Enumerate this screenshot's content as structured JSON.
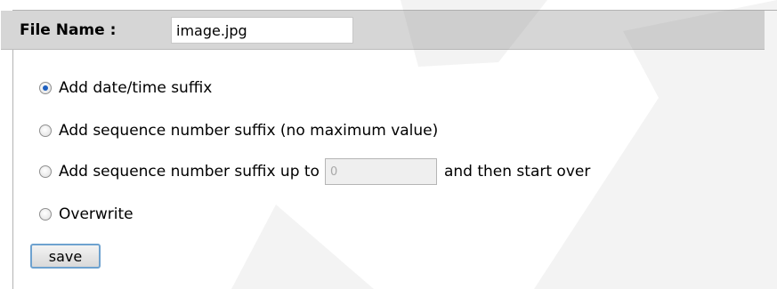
{
  "file_name": {
    "label": "File Name :",
    "value": "image.jpg"
  },
  "options": [
    {
      "label": "Add date/time suffix",
      "checked": true
    },
    {
      "label": "Add sequence number suffix (no maximum value)",
      "checked": false
    },
    {
      "label_before": "Add sequence number suffix up to",
      "input_value": "0",
      "label_after": "and then start over",
      "checked": false
    },
    {
      "label": "Overwrite",
      "checked": false
    }
  ],
  "save_label": "save",
  "colors": {
    "header_bg": "#d6d6d6",
    "radio_dot": "#1e5fbf",
    "button_border": "#6ea2cf"
  }
}
